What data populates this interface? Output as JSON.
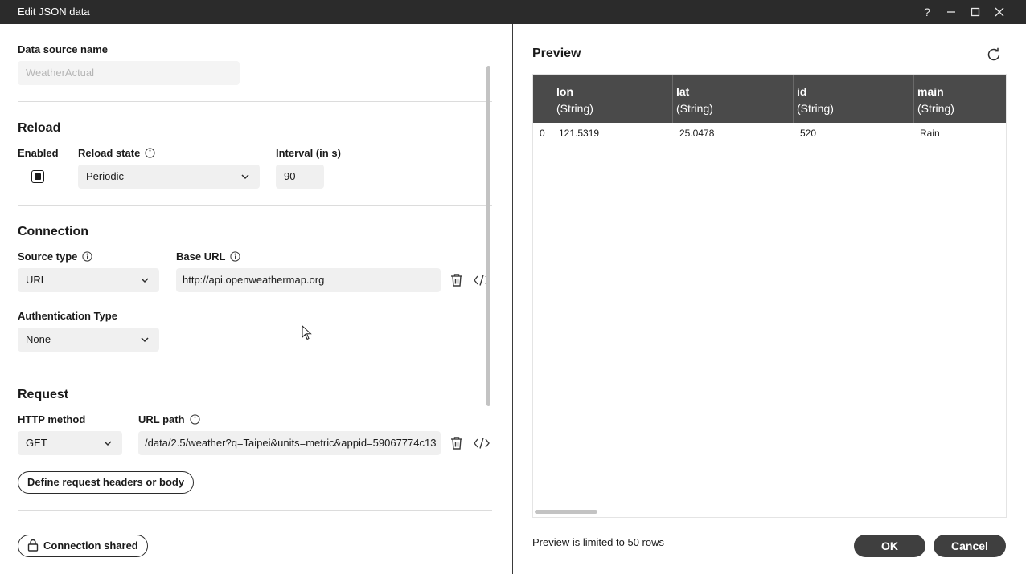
{
  "window": {
    "title": "Edit JSON data",
    "help_glyph": "?",
    "controls": [
      "minimize-icon",
      "maximize-icon",
      "close-icon"
    ]
  },
  "data_source": {
    "label": "Data source name",
    "value": "WeatherActual"
  },
  "reload": {
    "heading": "Reload",
    "enabled_label": "Enabled",
    "enabled_checked": true,
    "state_label": "Reload state",
    "state_value": "Periodic",
    "interval_label": "Interval (in s)",
    "interval_value": "90"
  },
  "connection": {
    "heading": "Connection",
    "source_type_label": "Source type",
    "source_type_value": "URL",
    "base_url_label": "Base URL",
    "base_url_value": "http://api.openweathermap.org",
    "auth_label": "Authentication Type",
    "auth_value": "None"
  },
  "request": {
    "heading": "Request",
    "method_label": "HTTP method",
    "method_value": "GET",
    "path_label": "URL path",
    "path_value": "/data/2.5/weather?q=Taipei&units=metric&appid=59067774c13",
    "define_button": "Define request headers or body"
  },
  "footer_left": {
    "shared_button": "Connection shared"
  },
  "preview": {
    "title": "Preview",
    "columns": [
      {
        "name": "lon",
        "type": "(String)"
      },
      {
        "name": "lat",
        "type": "(String)"
      },
      {
        "name": "id",
        "type": "(String)"
      },
      {
        "name": "main",
        "type": "(String)"
      }
    ],
    "rows": [
      {
        "index": "0",
        "cells": [
          "121.5319",
          "25.0478",
          "520",
          "Rain"
        ]
      }
    ],
    "limit_note": "Preview is limited to 50 rows"
  },
  "actions": {
    "ok": "OK",
    "cancel": "Cancel"
  }
}
